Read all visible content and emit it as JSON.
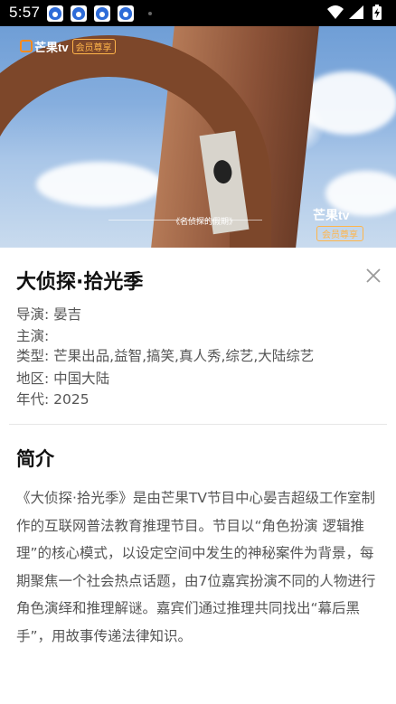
{
  "status_bar": {
    "time": "5:57",
    "notification_icons": [
      "baidu-paw-icon",
      "baidu-paw-icon",
      "baidu-paw-icon",
      "baidu-paw-icon"
    ],
    "right_icons": [
      "wifi-icon",
      "cellular-signal-icon",
      "battery-charging-icon"
    ]
  },
  "video": {
    "logo_top_left": "芒果tv",
    "badge_top_left": "会员尊享",
    "logo_bottom_right": "芒果tv",
    "badge_bottom_right": "会员尊享",
    "subtitle": "《名侦探的假期》"
  },
  "details": {
    "title": "大侦探·拾光季",
    "director_label": "导演:",
    "director": "晏吉",
    "cast_label": "主演:",
    "cast": "",
    "genre_label": "类型:",
    "genre": "芒果出品,益智,搞笑,真人秀,综艺,大陆综艺",
    "region_label": "地区:",
    "region": "中国大陆",
    "year_label": "年代:",
    "year": "2025"
  },
  "intro": {
    "heading": "简介",
    "text": "《大侦探·拾光季》是由芒果TV节目中心晏吉超级工作室制作的互联网普法教育推理节目。节目以“角色扮演 逻辑推理”的核心模式，以设定空间中发生的神秘案件为背景，每期聚焦一个社会热点话题，由7位嘉宾扮演不同的人物进行角色演绎和推理解谜。嘉宾们通过推理共同找出“幕后黑手”，用故事传递法律知识。"
  },
  "colors": {
    "accent_orange": "#ff8a1a",
    "text_dark": "#111111",
    "text_gray": "#555555"
  }
}
